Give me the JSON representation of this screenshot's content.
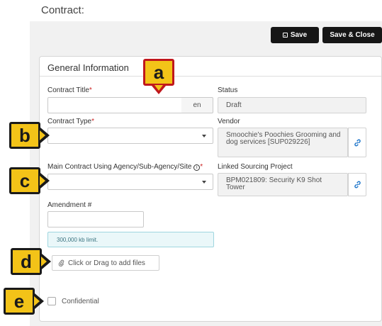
{
  "header": {
    "title": "Contract:"
  },
  "toolbar": {
    "save_label": "Save",
    "save_close_label": "Save & Close"
  },
  "panel": {
    "title": "General Information"
  },
  "fields": {
    "contract_title": {
      "label": "Contract Title",
      "required_mark": "*",
      "lang": "en",
      "value": ""
    },
    "status": {
      "label": "Status",
      "value": "Draft"
    },
    "contract_type": {
      "label": "Contract Type",
      "required_mark": "*",
      "value": ""
    },
    "vendor": {
      "label": "Vendor",
      "value": "Smoochie's Poochies Grooming and dog services [SUP029226]"
    },
    "main_contract_agency": {
      "label": "Main Contract Using Agency/Sub-Agency/Site",
      "required_mark": "*",
      "value": ""
    },
    "linked_sourcing_project": {
      "label": "Linked Sourcing Project",
      "value": "BPM021809: Security K9 Shot Tower"
    },
    "amendment": {
      "label": "Amendment #",
      "value": ""
    }
  },
  "attachments": {
    "limit_text": "300,000 kb limit.",
    "upload_label": "Click or Drag to add files"
  },
  "confidential": {
    "label": "Confidential",
    "checked": false
  },
  "callouts": {
    "a": "a",
    "b": "b",
    "c": "c",
    "d": "d",
    "e": "e"
  },
  "icons": {
    "save": "floppy-disk-icon",
    "info": "info-circle-icon",
    "link": "link-icon",
    "attach": "paperclip-icon",
    "dropdown": "caret-down-icon"
  },
  "colors": {
    "primary_button": "#161616",
    "callout_fill": "#f3c318",
    "callout_a_border": "#c0171c",
    "info_bg": "#eaf7f9",
    "required": "#cc2222",
    "link": "#1a73c9"
  }
}
